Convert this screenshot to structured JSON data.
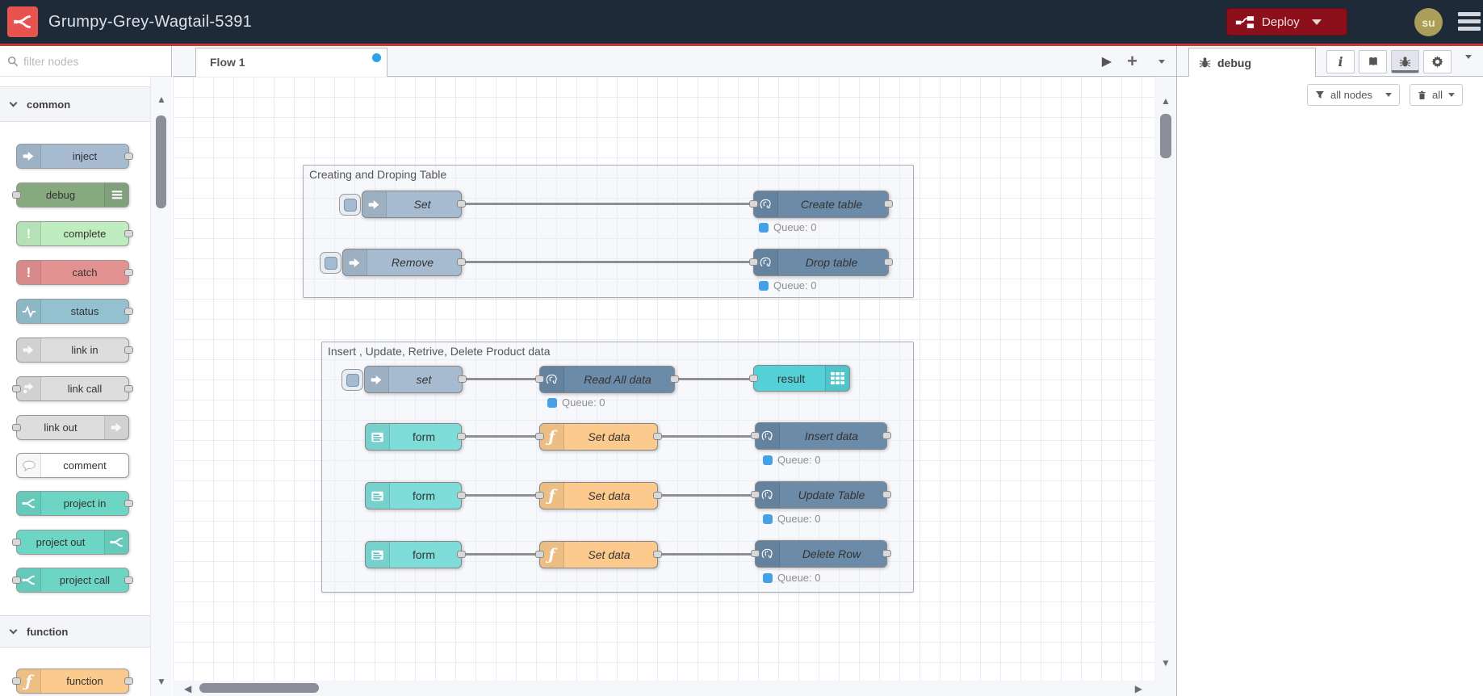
{
  "header": {
    "title": "Grumpy-Grey-Wagtail-5391",
    "deploy": "Deploy",
    "avatar": "su"
  },
  "palette": {
    "search_placeholder": "filter nodes",
    "category_common": "common",
    "category_function": "function",
    "items": {
      "inject": "inject",
      "debug": "debug",
      "complete": "complete",
      "catch": "catch",
      "status": "status",
      "link_in": "link in",
      "link_call": "link call",
      "link_out": "link out",
      "comment": "comment",
      "project_in": "project in",
      "project_out": "project out",
      "project_call": "project call",
      "function": "function"
    }
  },
  "workspace": {
    "tab": "Flow 1"
  },
  "flow": {
    "group1": {
      "title": "Creating and Droping Table",
      "inject1": "Set",
      "pg1": "Create table",
      "pg1_status": "Queue: 0",
      "inject2": "Remove",
      "pg2": "Drop table",
      "pg2_status": "Queue: 0"
    },
    "group2": {
      "title": "Insert , Update, Retrive, Delete Product data",
      "inject": "set",
      "read": "Read All data",
      "read_status": "Queue: 0",
      "result": "result",
      "form1": "form",
      "fn1": "Set data",
      "pg_insert": "Insert data",
      "insert_status": "Queue: 0",
      "form2": "form",
      "fn2": "Set data",
      "pg_update": "Update Table",
      "update_status": "Queue: 0",
      "form3": "form",
      "fn3": "Set data",
      "pg_delete": "Delete Row",
      "delete_status": "Queue: 0"
    }
  },
  "sidebar": {
    "tab": "debug",
    "filter": "all nodes",
    "clear": "all"
  },
  "colors": {
    "header_bg": "#1e2a38",
    "accent_red": "#c93434",
    "deploy_bg": "#8C101C",
    "logo_red": "#e8534e",
    "avatar_bg": "#ab9e58",
    "inject": "#a6bbcf",
    "debug": "#87a980",
    "complete": "#c0edc0",
    "catch": "#e49191",
    "status": "#94c1d0",
    "link": "#dddddd",
    "comment": "#ffffff",
    "project": "#6cd5c4",
    "function": "#fbca8c",
    "postgres": "#6b8ba8",
    "form": "#7eddd9",
    "result": "#54d1d6",
    "status_dot": "#45a1e6",
    "tab_dot": "#2ba3e8"
  }
}
